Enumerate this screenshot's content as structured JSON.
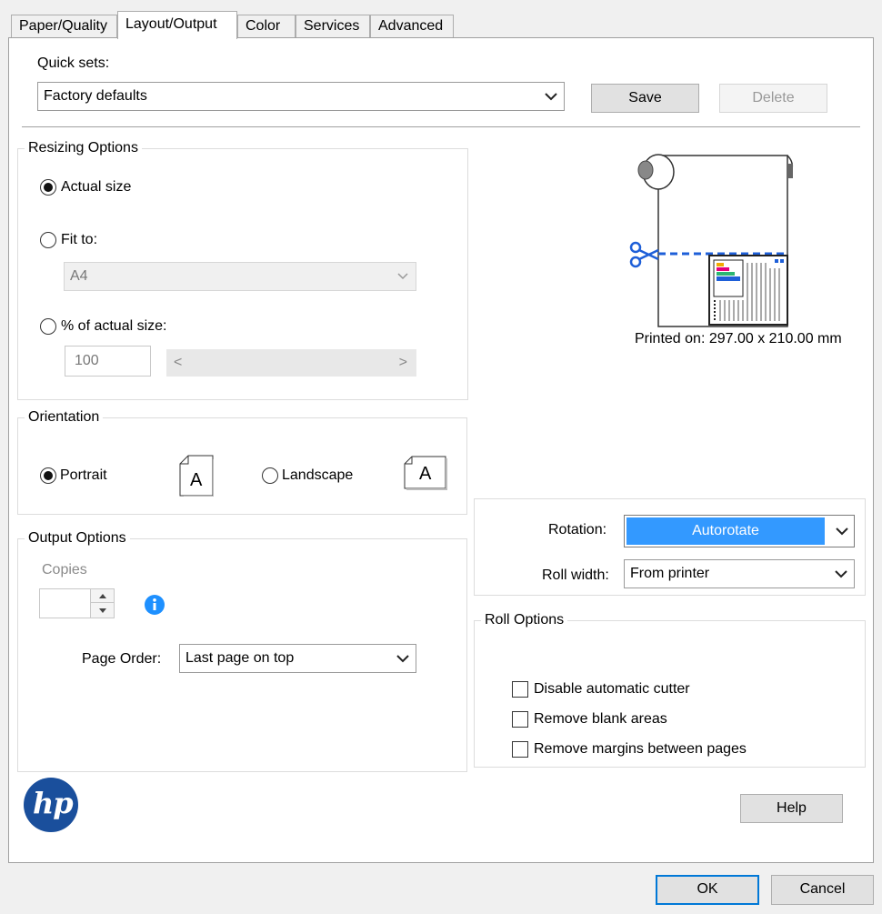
{
  "tabs": [
    {
      "label": "Paper/Quality"
    },
    {
      "label": "Layout/Output"
    },
    {
      "label": "Color"
    },
    {
      "label": "Services"
    },
    {
      "label": "Advanced"
    }
  ],
  "quick_sets": {
    "label": "Quick sets:",
    "value": "Factory defaults",
    "save_label": "Save",
    "delete_label": "Delete"
  },
  "resizing": {
    "title": "Resizing Options",
    "actual_size_label": "Actual size",
    "fit_to_label": "Fit to:",
    "fit_to_value": "A4",
    "percent_label": "% of actual size:",
    "percent_value": "100",
    "slider_left": "<",
    "slider_right": ">"
  },
  "orientation": {
    "title": "Orientation",
    "portrait_label": "Portrait",
    "landscape_label": "Landscape",
    "page_glyph": "A",
    "selected": "portrait"
  },
  "output": {
    "title": "Output Options",
    "copies_label": "Copies",
    "copies_value": "",
    "page_order_label": "Page Order:",
    "page_order_value": "Last page on top"
  },
  "preview": {
    "printed_on": "Printed on: 297.00 x 210.00 mm"
  },
  "rotation": {
    "label": "Rotation:",
    "value": "Autorotate",
    "roll_width_label": "Roll width:",
    "roll_width_value": "From printer"
  },
  "roll_options": {
    "title": "Roll Options",
    "items": [
      {
        "label": "Disable automatic cutter",
        "checked": false
      },
      {
        "label": "Remove blank areas",
        "checked": false
      },
      {
        "label": "Remove margins between pages",
        "checked": false
      }
    ]
  },
  "brand": {
    "logo_text": "hp",
    "color": "#1a4f9c"
  },
  "footer": {
    "help_label": "Help",
    "ok_label": "OK",
    "cancel_label": "Cancel"
  },
  "colors": {
    "accent": "#3399ff",
    "info": "#1e90ff",
    "cut_line": "#1e5fd8"
  }
}
